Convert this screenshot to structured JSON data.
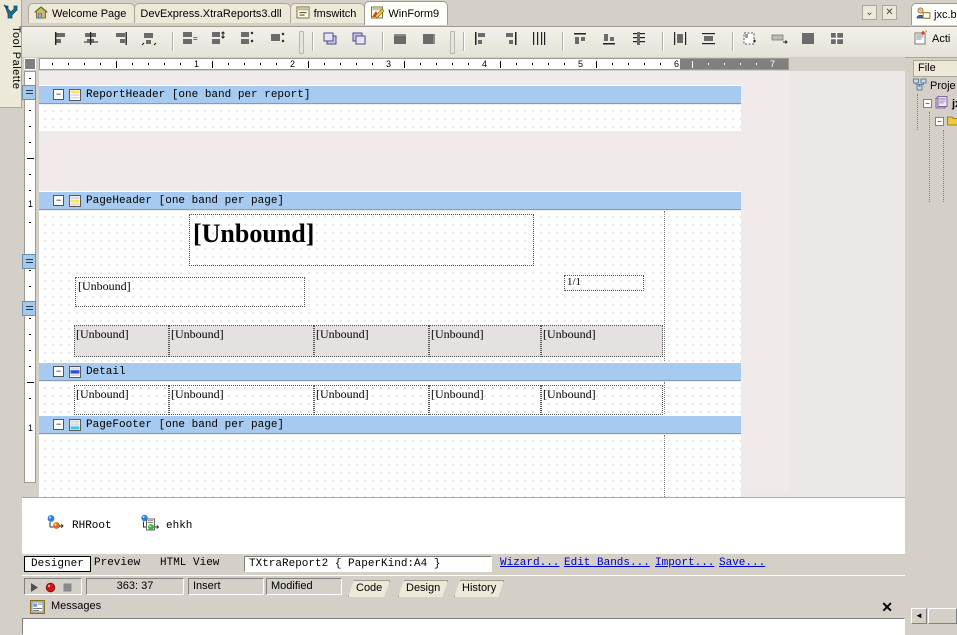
{
  "tool_palette": {
    "label": "Tool Palette",
    "icon": "wrench-icon"
  },
  "editor": {
    "tabs": [
      {
        "label": "Welcome Page",
        "icon": "home-icon",
        "active": false
      },
      {
        "label": "DevExpress.XtraReports3.dll",
        "icon": "none",
        "active": false
      },
      {
        "label": "fmswitch",
        "icon": "form-icon",
        "active": false
      },
      {
        "label": "WinForm9",
        "icon": "designer-icon",
        "active": true
      }
    ],
    "window_buttons": [
      {
        "name": "tab-list-button",
        "glyph": "⌄"
      },
      {
        "name": "close-tab-button",
        "glyph": "✕"
      }
    ],
    "toolbar_groups": [
      {
        "name": "align-group",
        "buttons": [
          "align-lefts",
          "align-horizontal-centers",
          "align-rights",
          "align-to-grid"
        ]
      },
      {
        "name": "size-group",
        "buttons": [
          "make-same-width",
          "make-same-height",
          "make-same-size",
          "size-to-grid"
        ]
      },
      {
        "name": "order-group",
        "buttons": [
          "bring-to-front",
          "send-to-back"
        ]
      },
      {
        "name": "center-group",
        "buttons": [
          "center-horizontally",
          "center-vertically"
        ]
      },
      {
        "name": "spacing-horizontal-group",
        "buttons": [
          "make-horizontal-spacing-equal",
          "increase-horizontal-spacing",
          "decrease-horizontal-spacing"
        ]
      },
      {
        "name": "spacing-vertical-group",
        "buttons": [
          "make-vertical-spacing-equal",
          "increase-vertical-spacing",
          "decrease-vertical-spacing"
        ]
      },
      {
        "name": "anchor-group",
        "buttons": [
          "remove-horizontal-spacing",
          "remove-vertical-spacing"
        ]
      },
      {
        "name": "tab-order-group",
        "buttons": [
          "lock-controls",
          "tab-order"
        ]
      }
    ]
  },
  "ruler": {
    "horizontal_numbers": [
      "1",
      "2",
      "3",
      "4",
      "5",
      "6",
      "7"
    ],
    "vertical_numbers": [
      "1",
      "1"
    ],
    "unit": "inch",
    "disabled_from": "6.4"
  },
  "report": {
    "bands": [
      {
        "name": "ReportHeader",
        "label": "ReportHeader [one band per report]",
        "icon": "report-header-icon",
        "expander": "−"
      },
      {
        "name": "PageHeader",
        "label": "PageHeader [one band per page]",
        "icon": "page-header-icon",
        "expander": "−"
      },
      {
        "name": "Detail",
        "label": "Detail",
        "icon": "detail-band-icon",
        "expander": "−"
      },
      {
        "name": "PageFooter",
        "label": "PageFooter [one band per page]",
        "icon": "page-footer-icon",
        "expander": "−"
      }
    ],
    "controls": {
      "title_label": "[Unbound]",
      "subtitle_label": "[Unbound]",
      "page_info": "1/1",
      "header_cells": [
        "[Unbound]",
        "[Unbound]",
        "[Unbound]",
        "[Unbound]",
        "[Unbound]"
      ],
      "detail_cells": [
        "[Unbound]",
        "[Unbound]",
        "[Unbound]",
        "[Unbound]",
        "[Unbound]"
      ]
    }
  },
  "tray": {
    "items": [
      {
        "label": "RHRoot",
        "icon": "component-icon"
      },
      {
        "label": "ehkh",
        "icon": "component-icon"
      }
    ]
  },
  "designer_bar": {
    "tabs": [
      {
        "label": "Designer",
        "selected": true
      },
      {
        "label": "Preview",
        "selected": false
      },
      {
        "label": "HTML View",
        "selected": false
      }
    ],
    "report_info": "TXtraReport2 { PaperKind:A4 }",
    "links": [
      "Wizard...",
      "Edit Bands...",
      "Import...",
      "Save..."
    ]
  },
  "status_bar": {
    "run_icons": [
      "run-icon",
      "stop-icon",
      "pause-icon"
    ],
    "cursor_position": "363: 37",
    "insert_mode": "Insert",
    "modified_state": "Modified",
    "view_tabs": [
      {
        "label": "Code",
        "selected": false
      },
      {
        "label": "Design",
        "selected": false
      },
      {
        "label": "History",
        "selected": false
      }
    ]
  },
  "messages": {
    "title": "Messages",
    "icon": "messages-icon",
    "close_glyph": "✕"
  },
  "right_panel": {
    "tab": {
      "label": "jxc.b",
      "icon": "user-icon"
    },
    "toolbar_button": {
      "label": "Acti",
      "icon": "new-item-icon"
    },
    "column_header": "File",
    "tree": [
      {
        "label": "Proje",
        "icon": "project-group-icon",
        "indent": 0,
        "expander": ""
      },
      {
        "label": "jx",
        "icon": "project-icon",
        "indent": 1,
        "expander": "−",
        "bold": true
      },
      {
        "label": "",
        "icon": "folder-icon",
        "indent": 2,
        "expander": "−",
        "bold": false
      }
    ],
    "scroll": {
      "left_arrow": "◄"
    }
  },
  "colors": {
    "band_blue": "#a6caf0",
    "link_blue": "#0000c0",
    "chrome": "#d4d0c8",
    "paper": "#f0eaea",
    "cell_fill": "#e6e1e1",
    "tab_active": "#fffffb"
  }
}
